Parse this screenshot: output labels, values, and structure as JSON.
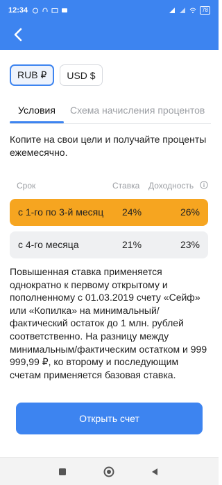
{
  "status_bar": {
    "time": "12:34",
    "battery": "78"
  },
  "currencies": [
    {
      "label": "RUB ₽",
      "selected": true
    },
    {
      "label": "USD $",
      "selected": false
    }
  ],
  "tabs": [
    {
      "label": "Условия",
      "active": true
    },
    {
      "label": "Схема начисления процентов",
      "active": false
    }
  ],
  "description": "Копите на свои цели и получайте проценты ежемесячно.",
  "rates_table": {
    "headers": {
      "term": "Срок",
      "rate": "Ставка",
      "yield": "Доходность"
    },
    "rows": [
      {
        "term": "с 1-го по 3-й месяц",
        "rate": "24%",
        "yield": "26%",
        "highlighted": true
      },
      {
        "term": "с 4-го месяца",
        "rate": "21%",
        "yield": "23%",
        "highlighted": false
      }
    ]
  },
  "note": "Повышенная ставка применяется однократно к первому открытому и пополненному с 01.03.2019 счету «Сейф» или «Копилка» на минимальный/фактический остаток до 1 млн. рублей соответственно. На разницу между минимальным/фактическим остатком и 999 999,99 ₽, ко второму и последующим счетам применяется базовая ставка.",
  "cta": {
    "label": "Открыть счет"
  },
  "colors": {
    "accent": "#3d84f0",
    "highlight_row": "#f6a520",
    "row_bg": "#eff0f2"
  }
}
